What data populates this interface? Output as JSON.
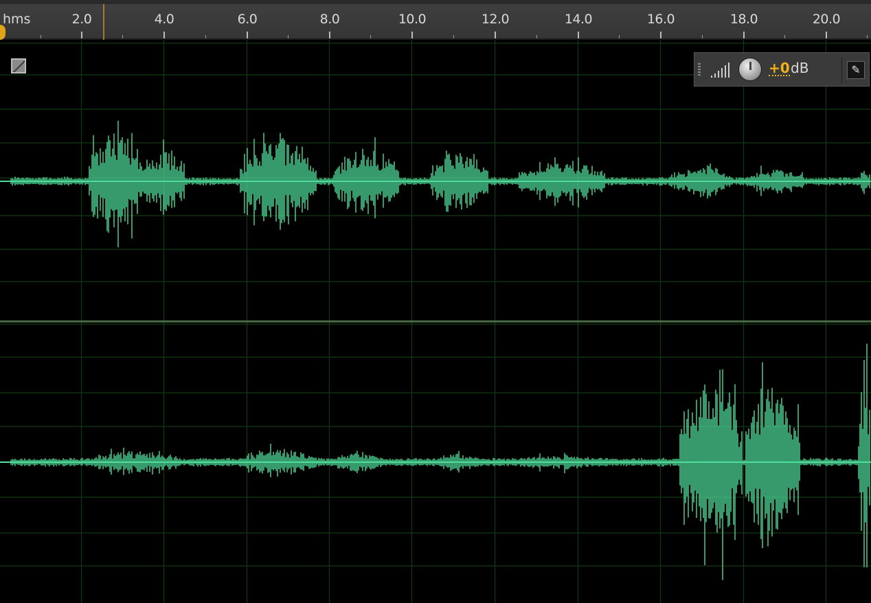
{
  "ruler": {
    "units": "hms",
    "labels": [
      "2.0",
      "4.0",
      "6.0",
      "8.0",
      "10.0",
      "12.0",
      "14.0",
      "16.0",
      "18.0",
      "20.0"
    ]
  },
  "hud": {
    "gain": "+0",
    "unit": "dB"
  },
  "icons": {
    "toggle": "envelope-toggle-icon",
    "level": "level-bars-icon",
    "volume": "volume-knob-icon",
    "pin": "pin-icon"
  },
  "colors": {
    "waveform": "#4fdc9a",
    "grid": "#123a12",
    "accent": "#f2b019",
    "background": "#000000"
  }
}
